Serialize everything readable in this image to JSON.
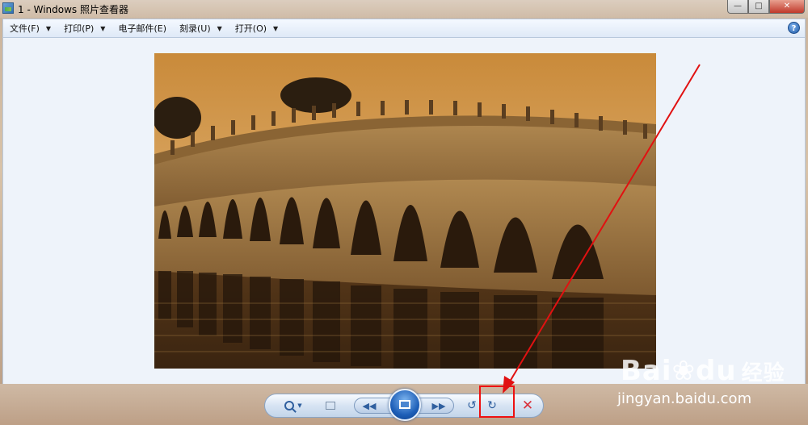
{
  "window": {
    "title": "1 - Windows 照片查看器",
    "controls": {
      "minimize": "—",
      "maximize": "□",
      "close": "✕"
    }
  },
  "menu": {
    "items": [
      {
        "label": "文件(F)"
      },
      {
        "label": "打印(P)"
      },
      {
        "label": "电子邮件(E)"
      },
      {
        "label": "刻录(U)"
      },
      {
        "label": "打开(O)"
      }
    ],
    "help": "?"
  },
  "photo": {
    "subject": "seventeen-arch-bridge-at-sunset"
  },
  "toolbar": {
    "zoom_icon": "zoom-icon",
    "actual_size_icon": "actual-size-icon",
    "prev_icon": "previous-icon",
    "slideshow_icon": "slideshow-icon",
    "next_icon": "next-icon",
    "rotate_left_icon": "rotate-counterclockwise-icon",
    "rotate_right_icon": "rotate-clockwise-icon",
    "delete_icon": "delete-icon",
    "prev_glyph": "◀◀",
    "next_glyph": "▶▶",
    "rotate_left_glyph": "↺",
    "rotate_right_glyph": "↻",
    "delete_glyph": "✕"
  },
  "annotation": {
    "color": "#e11111"
  },
  "watermark": {
    "logo": "Bai",
    "logo_mid": "du",
    "logo_cn": "经验",
    "url": "jingyan.baidu.com"
  }
}
